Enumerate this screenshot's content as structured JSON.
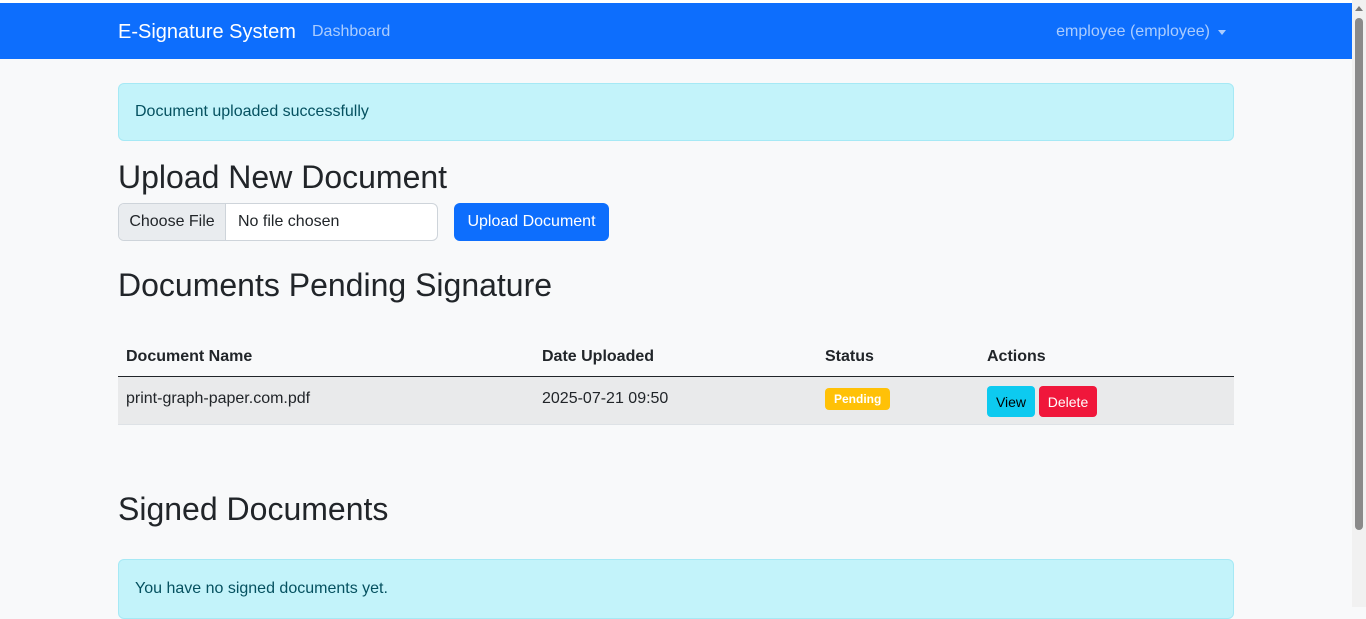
{
  "navbar": {
    "brand": "E-Signature System",
    "dashboard_link": "Dashboard",
    "user_menu": "employee (employee)"
  },
  "alerts": {
    "upload_success": "Document uploaded successfully",
    "no_signed": "You have no signed documents yet."
  },
  "upload": {
    "heading": "Upload New Document",
    "choose_file_label": "Choose File",
    "file_status": "No file chosen",
    "submit_label": "Upload Document"
  },
  "pending": {
    "heading": "Documents Pending Signature",
    "columns": [
      "Document Name",
      "Date Uploaded",
      "Status",
      "Actions"
    ],
    "rows": [
      {
        "name": "print-graph-paper.com.pdf",
        "date": "2025-07-21 09:50",
        "status": "Pending",
        "view_label": "View",
        "delete_label": "Delete"
      }
    ]
  },
  "signed": {
    "heading": "Signed Documents"
  },
  "colors": {
    "primary": "#0d6efd",
    "info_alert_bg": "#c3f3fa",
    "badge_pending": "#ffc107",
    "btn_view": "#0dcaf0",
    "btn_delete": "#f0173b"
  }
}
